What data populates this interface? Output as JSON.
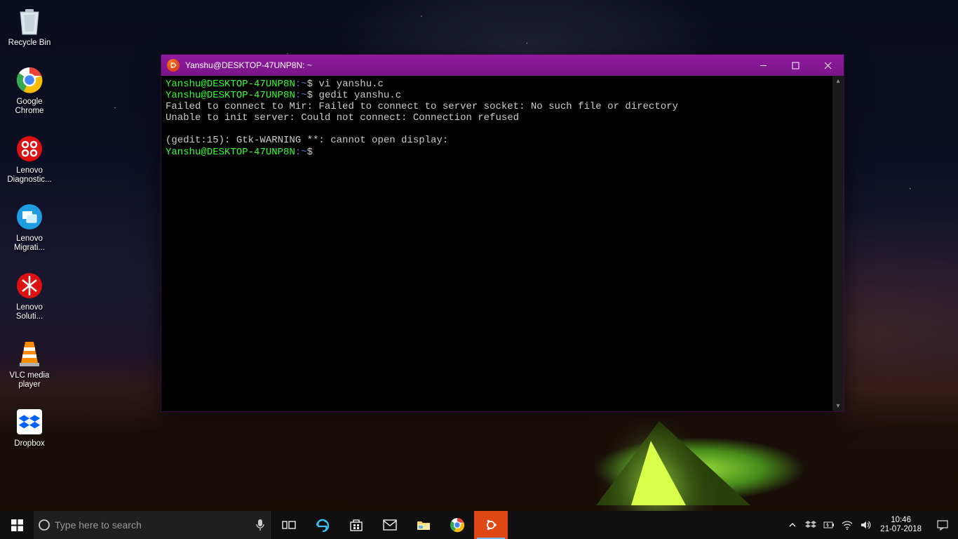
{
  "desktop": {
    "icons": [
      {
        "name": "recycle-bin",
        "label": "Recycle Bin"
      },
      {
        "name": "google-chrome",
        "label": "Google Chrome"
      },
      {
        "name": "lenovo-diagnostics",
        "label": "Lenovo Diagnostic..."
      },
      {
        "name": "lenovo-migration",
        "label": "Lenovo Migrati..."
      },
      {
        "name": "lenovo-solution",
        "label": "Lenovo Soluti..."
      },
      {
        "name": "vlc",
        "label": "VLC media player"
      },
      {
        "name": "dropbox",
        "label": "Dropbox"
      }
    ]
  },
  "terminal": {
    "title": "Yanshu@DESKTOP-47UNP8N: ~",
    "prompt": {
      "user": "Yanshu",
      "host": "DESKTOP-47UNP8N",
      "path": "~",
      "sep": "@",
      "colon": ":",
      "dollar": "$"
    },
    "line1_cmd": " vi yanshu.c",
    "line2_cmd": " gedit yanshu.c",
    "out1": "Failed to connect to Mir: Failed to connect to server socket: No such file or directory",
    "out2": "Unable to init server: Could not connect: Connection refused",
    "out3": "",
    "out4": "(gedit:15): Gtk-WARNING **: cannot open display:"
  },
  "taskbar": {
    "search_placeholder": "Type here to search",
    "time": "10:46",
    "date": "21-07-2018",
    "items": [
      {
        "name": "task-view",
        "icon": "taskview"
      },
      {
        "name": "edge",
        "icon": "edge"
      },
      {
        "name": "store",
        "icon": "store"
      },
      {
        "name": "mail",
        "icon": "mail"
      },
      {
        "name": "file-explorer",
        "icon": "folder"
      },
      {
        "name": "chrome",
        "icon": "chrome"
      },
      {
        "name": "ubuntu",
        "icon": "ubuntu",
        "active": true
      }
    ],
    "tray_chevron": "chevron-up",
    "tray_items": [
      "dropbox",
      "power",
      "wifi",
      "volume"
    ]
  }
}
